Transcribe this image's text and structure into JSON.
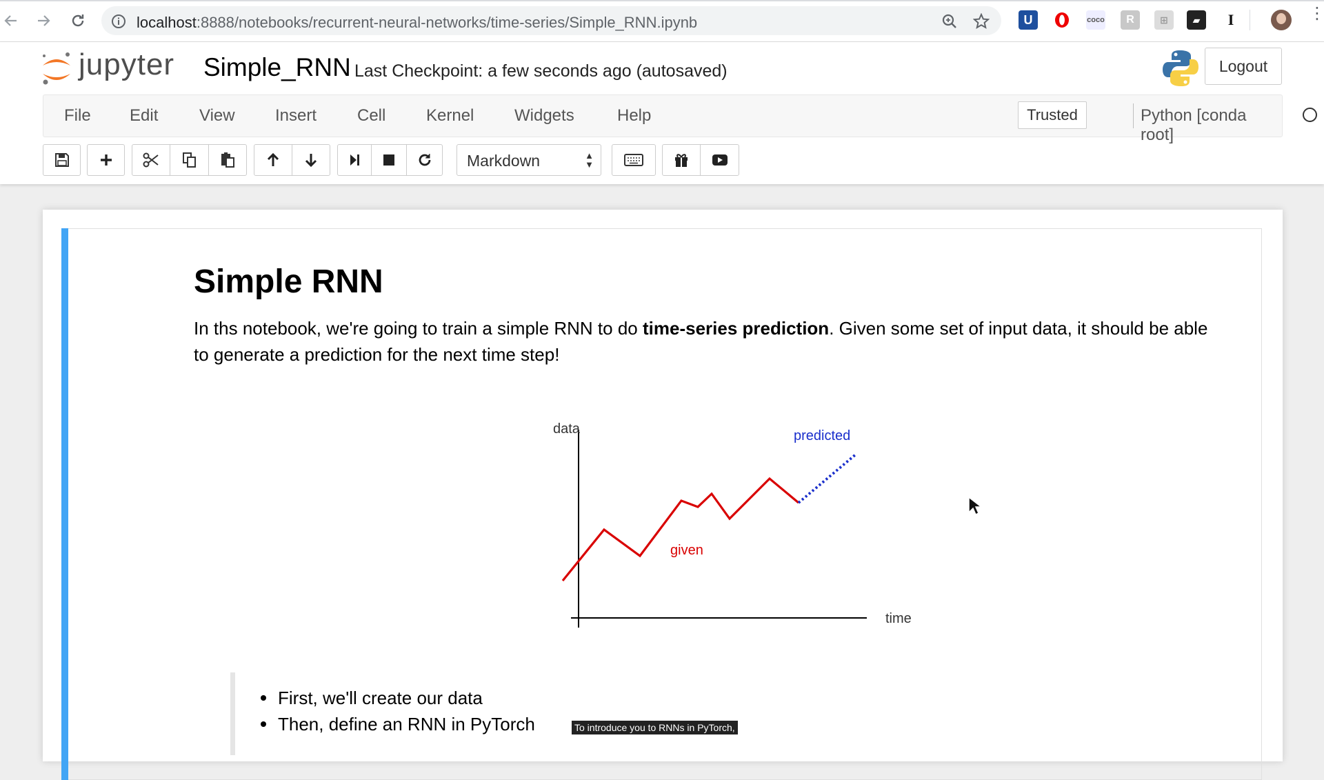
{
  "browser": {
    "url_host": "localhost",
    "url_path": ":8888/notebooks/recurrent-neural-networks/time-series/Simple_RNN.ipynb"
  },
  "header": {
    "logo_text": "jupyter",
    "notebook_name": "Simple_RNN",
    "checkpoint": "Last Checkpoint: a few seconds ago (autosaved)",
    "logout_label": "Logout"
  },
  "menu": {
    "items": [
      "File",
      "Edit",
      "View",
      "Insert",
      "Cell",
      "Kernel",
      "Widgets",
      "Help"
    ],
    "trusted_label": "Trusted",
    "kernel_name": "Python [conda root]"
  },
  "toolbar": {
    "cell_type": "Markdown"
  },
  "cell": {
    "title": "Simple RNN",
    "para_before": "In ths notebook, we're going to train a simple RNN to do ",
    "para_bold": "time-series prediction",
    "para_after": ". Given some set of input data, it should be able to generate a prediction for the next time step!",
    "bullets": [
      "First, we'll create our data",
      "Then, define an RNN in PyTorch"
    ]
  },
  "diagram": {
    "ylabel": "data",
    "xlabel": "time",
    "given_label": "given",
    "predicted_label": "predicted",
    "given_color": "#d90000",
    "predicted_color": "#1a2fcc"
  },
  "caption": "To introduce you to RNNs in PyTorch,"
}
